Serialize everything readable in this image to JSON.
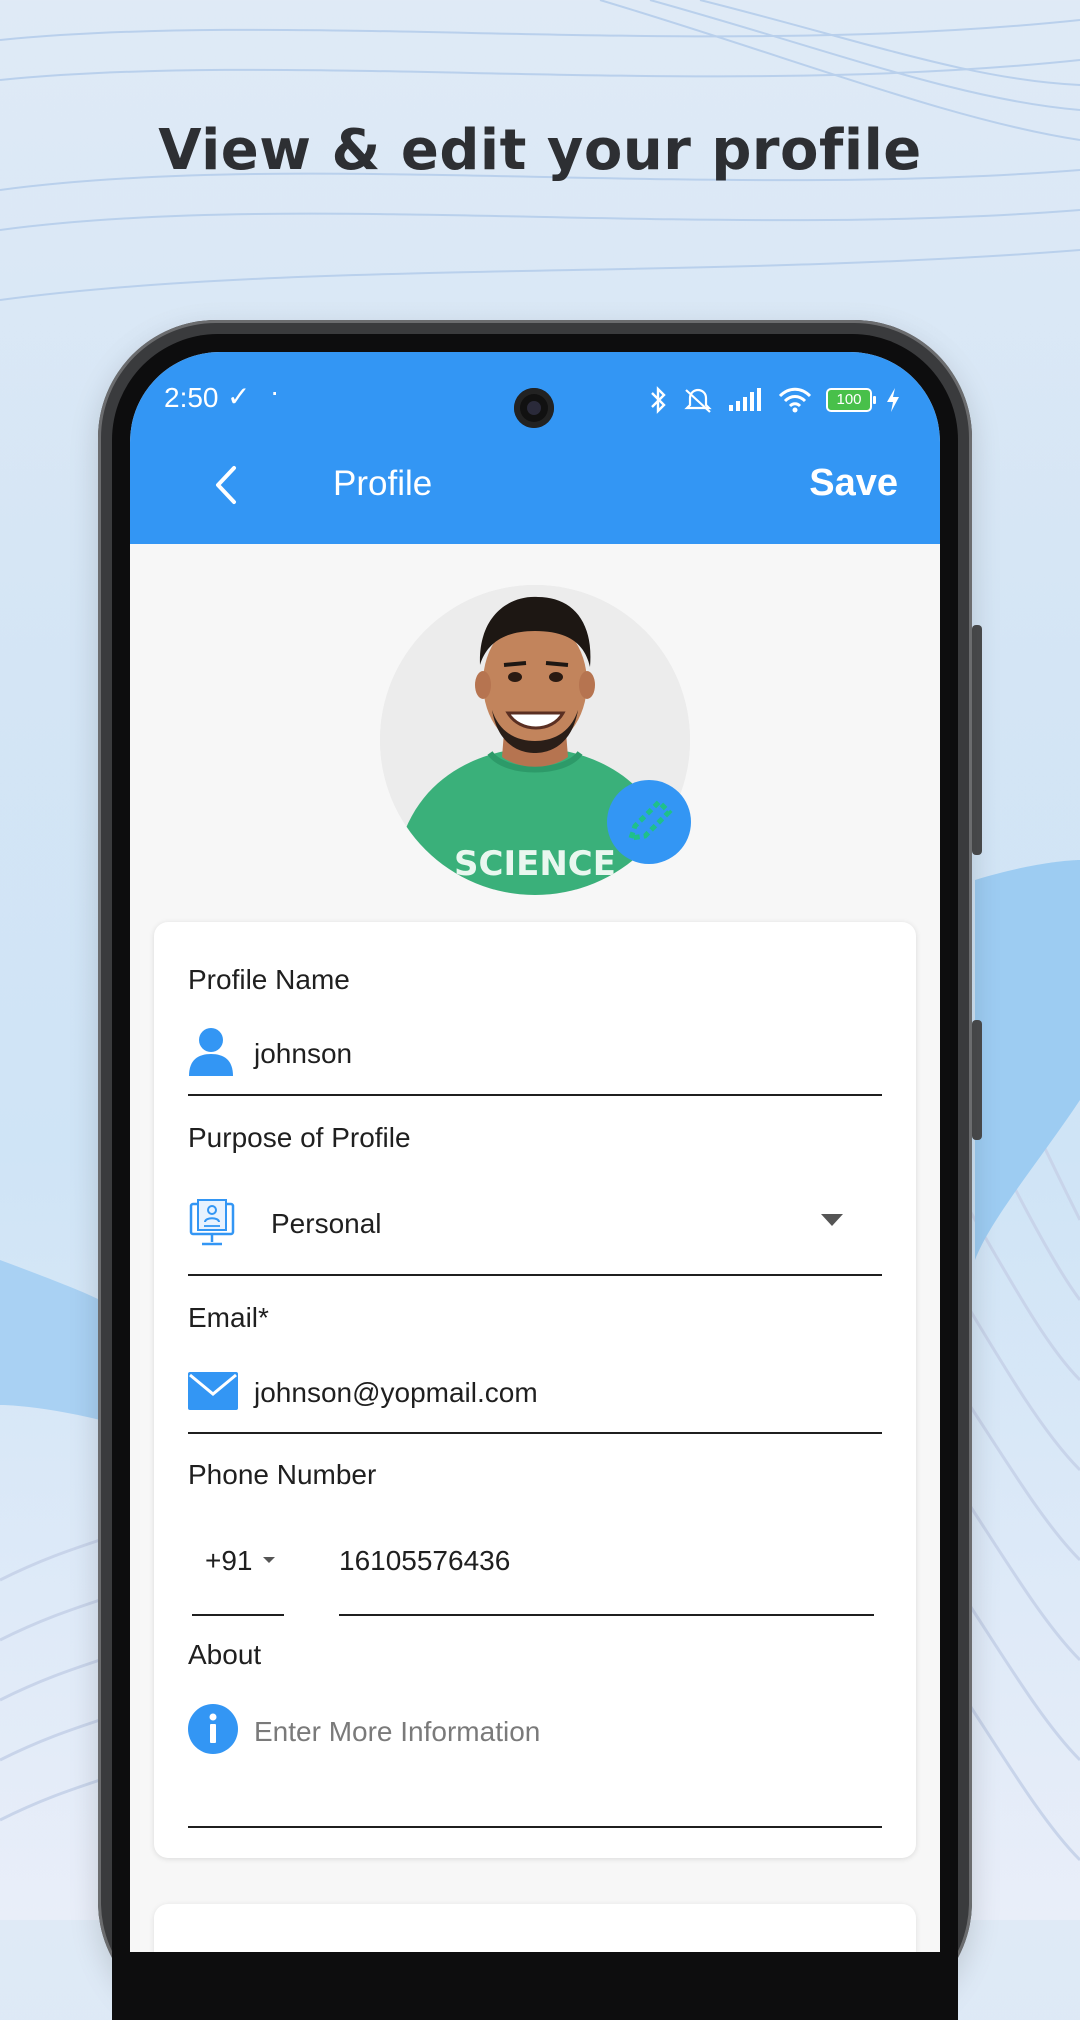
{
  "headline": "View & edit your profile",
  "status_bar": {
    "time": "2:50",
    "battery": "100"
  },
  "app_bar": {
    "title": "Profile",
    "save_label": "Save"
  },
  "form": {
    "profile_name": {
      "label": "Profile Name",
      "value": "johnson"
    },
    "purpose": {
      "label": "Purpose of Profile",
      "value": "Personal"
    },
    "email": {
      "label": "Email*",
      "value": "johnson@yopmail.com"
    },
    "phone": {
      "label": "Phone Number",
      "country_code": "+91",
      "value": "16105576436"
    },
    "about": {
      "label": "About",
      "placeholder": "Enter More Information"
    }
  },
  "colors": {
    "accent": "#3396f4",
    "text": "#1f1f1f"
  },
  "icons": [
    "back-chevron-icon",
    "person-icon",
    "profile-purpose-icon",
    "dropdown-caret-icon",
    "mail-icon",
    "info-icon",
    "pencil-icon",
    "bluetooth-icon",
    "mute-icon",
    "signal-icon",
    "wifi-icon",
    "battery-icon",
    "charging-icon"
  ]
}
